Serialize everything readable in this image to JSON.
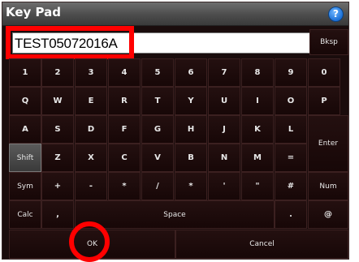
{
  "window": {
    "title": "Key Pad",
    "help_icon": "help-icon",
    "help_glyph": "?"
  },
  "entry": {
    "value": "TEST05072016A"
  },
  "keys": {
    "bksp": "Bksp",
    "row1": [
      "1",
      "2",
      "3",
      "4",
      "5",
      "6",
      "7",
      "8",
      "9",
      "0"
    ],
    "row2": [
      "Q",
      "W",
      "E",
      "R",
      "T",
      "Y",
      "U",
      "I",
      "O",
      "P"
    ],
    "row3": [
      "A",
      "S",
      "D",
      "F",
      "G",
      "H",
      "J",
      "K",
      "L"
    ],
    "enter": "Enter",
    "shift": "Shift",
    "row4": [
      "Z",
      "X",
      "C",
      "V",
      "B",
      "N",
      "M",
      "="
    ],
    "sym": "Sym",
    "row5": [
      "+",
      "-",
      "*",
      "/",
      "*",
      "'",
      "\"",
      "#"
    ],
    "num": "Num",
    "calc": "Calc",
    "comma": ",",
    "space": "Space",
    "period": ".",
    "at": "@",
    "ok": "OK",
    "cancel": "Cancel"
  },
  "colors": {
    "background": "#1a0c0c",
    "annotation": "#ff0000",
    "help": "#1b6fd6"
  }
}
